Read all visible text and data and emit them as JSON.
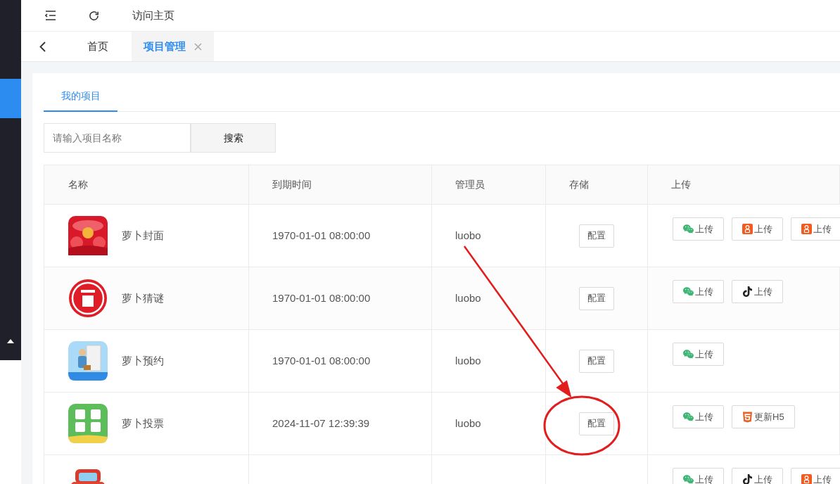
{
  "topbar": {
    "link": "访问主页"
  },
  "tabs": [
    {
      "label": "首页",
      "selected": false,
      "closable": false
    },
    {
      "label": "项目管理",
      "selected": true,
      "closable": true
    }
  ],
  "panel_tabs": [
    {
      "label": "我的项目",
      "selected": true
    }
  ],
  "search": {
    "placeholder": "请输入项目名称",
    "button": "搜索"
  },
  "table": {
    "columns": [
      "名称",
      "到期时间",
      "管理员",
      "存储",
      "上传"
    ],
    "rows": [
      {
        "name": "萝卜封面",
        "expires": "1970-01-01 08:00:00",
        "admin": "luobo",
        "config": "配置",
        "uploads": [
          {
            "kind": "wechat",
            "label": "上传"
          },
          {
            "kind": "kuaishou",
            "label": "上传"
          },
          {
            "kind": "kuaishou",
            "label": "上传"
          }
        ]
      },
      {
        "name": "萝卜猜谜",
        "expires": "1970-01-01 08:00:00",
        "admin": "luobo",
        "config": "配置",
        "uploads": [
          {
            "kind": "wechat",
            "label": "上传"
          },
          {
            "kind": "douyin",
            "label": "上传"
          }
        ]
      },
      {
        "name": "萝卜预约",
        "expires": "1970-01-01 08:00:00",
        "admin": "luobo",
        "config": "配置",
        "uploads": [
          {
            "kind": "wechat",
            "label": "上传"
          }
        ]
      },
      {
        "name": "萝卜投票",
        "expires": "2024-11-07 12:39:39",
        "admin": "luobo",
        "config": "配置",
        "uploads": [
          {
            "kind": "wechat",
            "label": "上传"
          },
          {
            "kind": "h5",
            "label": "更新H5"
          }
        ]
      },
      {
        "uploads": [
          {
            "kind": "wechat",
            "label": "上传"
          },
          {
            "kind": "douyin",
            "label": "上传"
          },
          {
            "kind": "kuaishou",
            "label": "上传"
          }
        ]
      }
    ]
  }
}
